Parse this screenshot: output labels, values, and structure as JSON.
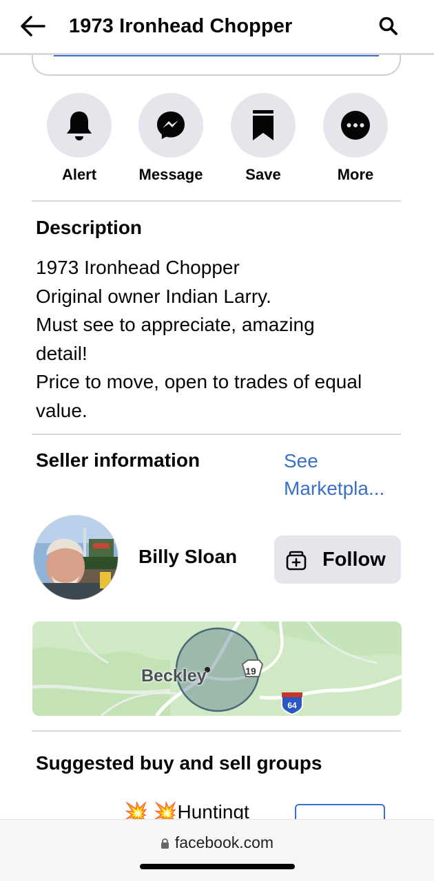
{
  "header": {
    "title": "1973 Ironhead Chopper",
    "back_icon": "arrow-left-icon",
    "search_icon": "search-icon"
  },
  "actions": [
    {
      "label": "Alert",
      "icon": "bell-icon"
    },
    {
      "label": "Message",
      "icon": "messenger-icon"
    },
    {
      "label": "Save",
      "icon": "bookmark-icon"
    },
    {
      "label": "More",
      "icon": "more-dots-icon"
    }
  ],
  "description": {
    "title": "Description",
    "lines": [
      "1973 Ironhead Chopper",
      "Original owner Indian Larry.",
      "Must see to appreciate, amazing",
      "detail!",
      "Price to move, open to trades of equal",
      "value."
    ]
  },
  "seller": {
    "title": "Seller information",
    "see_link_line1": "See",
    "see_link_line2": "Marketpla...",
    "name": "Billy Sloan",
    "follow_label": "Follow"
  },
  "map": {
    "place": "Beckley",
    "route_us": "19",
    "route_interstate": "64"
  },
  "groups": {
    "title": "Suggested buy and sell groups",
    "first_group_name": "💥 💥Huntingt"
  },
  "browser": {
    "url": "facebook.com"
  },
  "colors": {
    "link": "#3a70c6",
    "button_bg": "#e4e6eb",
    "map_land": "#cfe9c4"
  }
}
